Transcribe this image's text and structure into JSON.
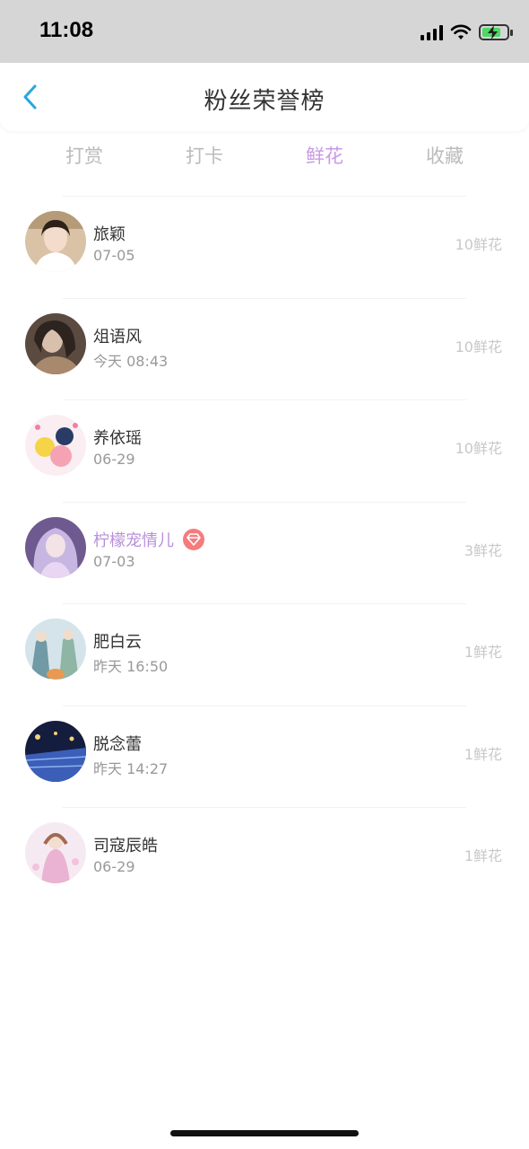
{
  "status_bar": {
    "time": "11:08",
    "icons": [
      "signal-icon",
      "wifi-icon",
      "battery-charging-icon"
    ]
  },
  "header": {
    "title": "粉丝荣誉榜",
    "back_icon": "chevron-left-icon"
  },
  "tabs": [
    {
      "label": "打赏",
      "active": false
    },
    {
      "label": "打卡",
      "active": false
    },
    {
      "label": "鲜花",
      "active": true
    },
    {
      "label": "收藏",
      "active": false
    }
  ],
  "colors": {
    "accent": "#c99ae6",
    "back": "#2aa5e0",
    "vip_badge": "#f47c7c"
  },
  "fans": [
    {
      "name": "旅颖",
      "time": "07-05",
      "count": "10鲜花",
      "vip": false
    },
    {
      "name": "俎语风",
      "time": "今天 08:43",
      "count": "10鲜花",
      "vip": false
    },
    {
      "name": "养依瑶",
      "time": "06-29",
      "count": "10鲜花",
      "vip": false
    },
    {
      "name": "柠檬宠情儿",
      "time": "07-03",
      "count": "3鲜花",
      "vip": true
    },
    {
      "name": "肥白云",
      "time": "昨天 16:50",
      "count": "1鲜花",
      "vip": false
    },
    {
      "name": "脱念蕾",
      "time": "昨天 14:27",
      "count": "1鲜花",
      "vip": false
    },
    {
      "name": "司寇辰皓",
      "time": "06-29",
      "count": "1鲜花",
      "vip": false
    }
  ]
}
